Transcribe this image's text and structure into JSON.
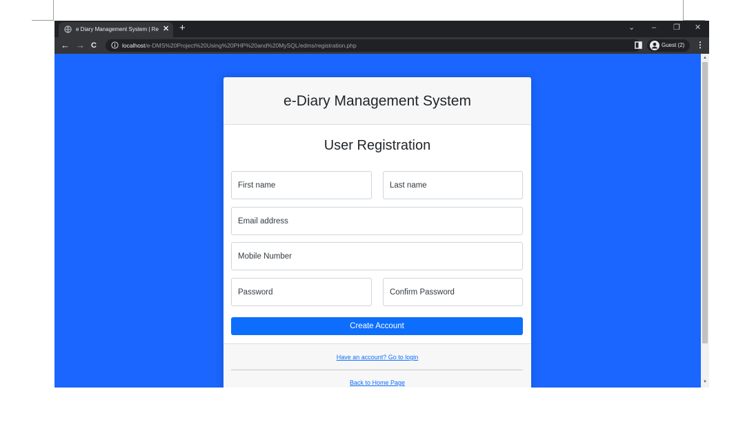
{
  "browser": {
    "tab_title": "e Diary Management System | Re",
    "tab_close_glyph": "✕",
    "new_tab_glyph": "+",
    "url_host": "localhost",
    "url_path": "/e-DMS%20Project%20Using%20PHP%20and%20MySQL/edms/registration.php",
    "profile_label": "Guest (2)",
    "back_glyph": "←",
    "forward_glyph": "→",
    "reload_glyph": "C",
    "menu_glyph": "⋮",
    "tab_search_glyph": "⌄",
    "minimize_glyph": "–",
    "restore_glyph": "❐",
    "close_glyph": "✕"
  },
  "page": {
    "app_title": "e-Diary Management System",
    "form_title": "User Registration",
    "fields": {
      "first_name": "First name",
      "last_name": "Last name",
      "email": "Email address",
      "mobile": "Mobile Number",
      "password": "Password",
      "confirm_password": "Confirm Password"
    },
    "submit_label": "Create Account",
    "login_link": "Have an account? Go to login",
    "home_link": "Back to Home Page"
  },
  "colors": {
    "page_background": "#1a66ff",
    "primary_button": "#0d6efd",
    "browser_chrome": "#35363a"
  }
}
